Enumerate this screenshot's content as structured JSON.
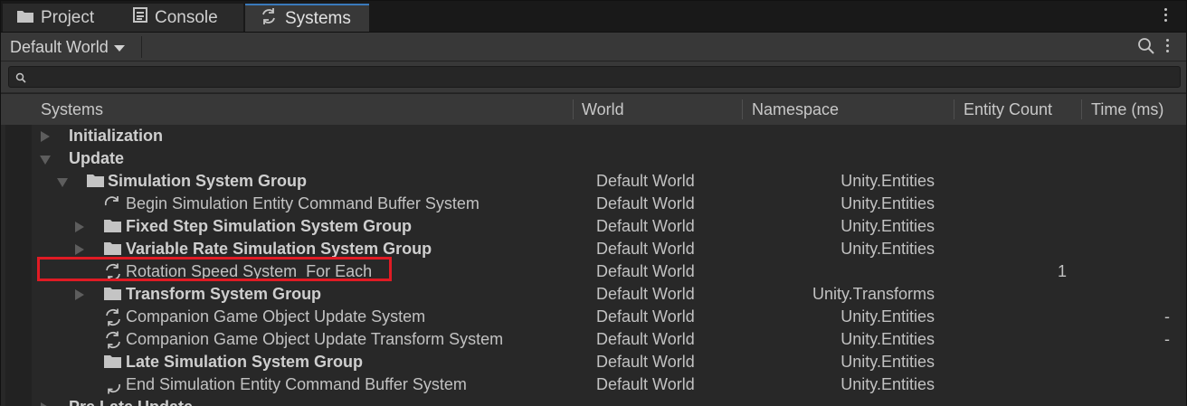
{
  "tabs": [
    {
      "label": "Project",
      "icon": "folder-icon"
    },
    {
      "label": "Console",
      "icon": "console-icon"
    },
    {
      "label": "Systems",
      "icon": "refresh-icon"
    }
  ],
  "toolbar": {
    "world_dropdown": "Default World"
  },
  "search": {
    "value": "",
    "placeholder": ""
  },
  "columns": {
    "systems": "Systems",
    "world": "World",
    "namespace": "Namespace",
    "entity_count": "Entity Count",
    "time": "Time (ms)"
  },
  "rows": [
    {
      "name": "Initialization",
      "world": "",
      "namespace": "",
      "count": "",
      "time": ""
    },
    {
      "name": "Update",
      "world": "",
      "namespace": "",
      "count": "",
      "time": ""
    },
    {
      "name": "Simulation System Group",
      "world": "Default World",
      "namespace": "Unity.Entities",
      "count": "",
      "time": ""
    },
    {
      "name": "Begin Simulation Entity Command Buffer System",
      "world": "Default World",
      "namespace": "Unity.Entities",
      "count": "",
      "time": ""
    },
    {
      "name": "Fixed Step Simulation System Group",
      "world": "Default World",
      "namespace": "Unity.Entities",
      "count": "",
      "time": ""
    },
    {
      "name": "Variable Rate Simulation System Group",
      "world": "Default World",
      "namespace": "Unity.Entities",
      "count": "",
      "time": ""
    },
    {
      "name": "Rotation Speed System_For Each",
      "world": "Default World",
      "namespace": "",
      "count": "1",
      "time": ""
    },
    {
      "name": "Transform System Group",
      "world": "Default World",
      "namespace": "Unity.Transforms",
      "count": "",
      "time": ""
    },
    {
      "name": "Companion Game Object Update System",
      "world": "Default World",
      "namespace": "Unity.Entities",
      "count": "",
      "time": "-"
    },
    {
      "name": "Companion Game Object Update Transform System",
      "world": "Default World",
      "namespace": "Unity.Entities",
      "count": "",
      "time": "-"
    },
    {
      "name": "Late Simulation System Group",
      "world": "Default World",
      "namespace": "Unity.Entities",
      "count": "",
      "time": ""
    },
    {
      "name": "End Simulation Entity Command Buffer System",
      "world": "Default World",
      "namespace": "Unity.Entities",
      "count": "",
      "time": ""
    },
    {
      "name": "Pre Late Update",
      "world": "",
      "namespace": "",
      "count": "",
      "time": ""
    }
  ],
  "colors": {
    "accent": "#3a79bb",
    "highlight": "#e01b24",
    "background": "#282828"
  }
}
